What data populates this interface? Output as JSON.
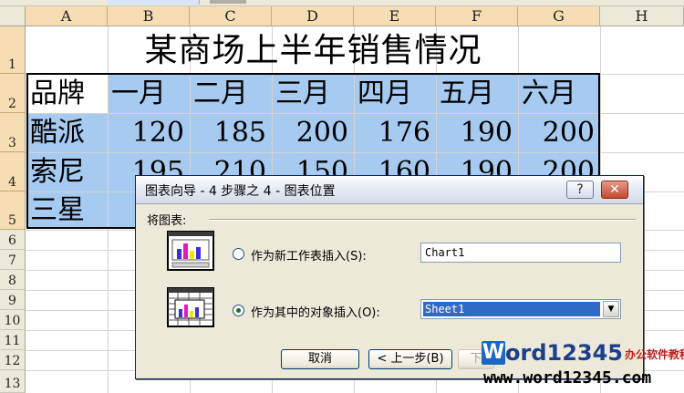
{
  "columns": [
    "A",
    "B",
    "C",
    "D",
    "E",
    "F",
    "G",
    "H"
  ],
  "rows": [
    "1",
    "2",
    "3",
    "4",
    "5",
    "6",
    "7",
    "8",
    "9",
    "10",
    "11",
    "12",
    "13"
  ],
  "sheet_title": "某商场上半年销售情况",
  "table": {
    "header": [
      "品牌",
      "一月",
      "二月",
      "三月",
      "四月",
      "五月",
      "六月"
    ],
    "data": [
      {
        "brand": "酷派",
        "values": [
          "120",
          "185",
          "200",
          "176",
          "190",
          "200"
        ]
      },
      {
        "brand": "索尼",
        "values": [
          "195",
          "210",
          "150",
          "160",
          "190",
          "200"
        ]
      },
      {
        "brand": "三星",
        "values": [
          "",
          "",
          "",
          "",
          "",
          ""
        ]
      }
    ]
  },
  "dialog": {
    "title": "图表向导 - 4 步骤之 4 - 图表位置",
    "help_symbol": "?",
    "close_symbol": "✕",
    "group_label": "将图表:",
    "option_new_sheet": "作为新工作表插入(S):",
    "option_object": "作为其中的对象插入(O):",
    "new_sheet_value": "Chart1",
    "object_value": "Sheet1",
    "selected_option": "object",
    "cancel_label": "取消",
    "back_label": "< 上一步(B)",
    "next_label": "下"
  },
  "watermark": {
    "logo_letter": "W",
    "brand": "ord12345",
    "tagline": "办公软件教程",
    "url": "www.word12345.com"
  },
  "colors": {
    "selection": "#a6caf0",
    "selected_header": "#f6ddb3",
    "dialog_bg": "#ece9d8",
    "watermark_blue": "#1d67c4",
    "watermark_red": "#c21b1b"
  }
}
